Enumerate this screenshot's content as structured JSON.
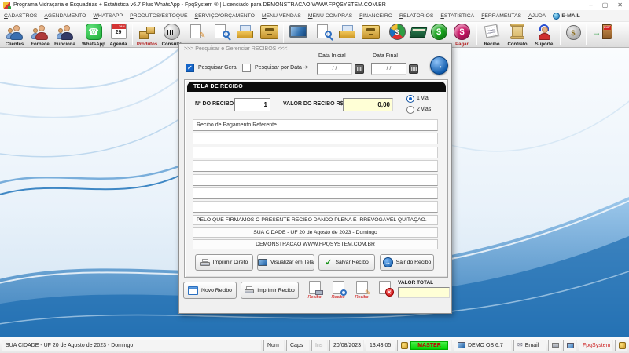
{
  "icons": {
    "check": "✓",
    "arrow": "→",
    "phone": "☎",
    "pencil": "✎",
    "dollar": "$",
    "x_mark": "✕",
    "envelope": "✉"
  },
  "window": {
    "title": "Programa Vidraçaria e Esquadrias + Estatistica v6.7 Plus WhatsApp - FpqSystem ® | Licenciado para DEMONSTRACAO WWW.FPQSYSTEM.COM.BR",
    "minimize": "–",
    "maximize": "▢",
    "close": "✕"
  },
  "menubar": {
    "items": [
      "CADASTROS",
      "AGENDAMENTO",
      "WHATSAPP",
      "PRODUTOS/ESTOQUE",
      "SERVIÇO/ORÇAMENTO",
      "MENU VENDAS",
      "MENU COMPRAS",
      "FINANCEIRO",
      "RELATÓRIOS",
      "ESTATISTICA",
      "FERRAMENTAS",
      "AJUDA"
    ],
    "email": "E-MAIL"
  },
  "toolbar": {
    "clientes": "Clientes",
    "fornece": "Fornece",
    "funciona": "Funciona",
    "whatsapp": "WhatsApp",
    "agenda": "Agenda",
    "agenda_month": "JAN",
    "agenda_day": "29",
    "produtos": "Produtos",
    "consulta": "Consulta",
    "pagar": "Pagar",
    "recibo": "Recibo",
    "contrato": "Contrato",
    "suporte": "Suporte",
    "exit_sign": "EXIT"
  },
  "dialog": {
    "title": ">>> Pesquisar e Gerenciar RECIBOS  <<<",
    "pesquisar_geral": "Pesquisar Geral",
    "pesquisar_por_data": "Pesquisar por Data ->",
    "data_inicial": {
      "label": "Data Inicial",
      "value": "/ /"
    },
    "data_final": {
      "label": "Data Final",
      "value": "/ /"
    },
    "tela": {
      "header": "TELA DE RECIBO",
      "numero_label": "Nº DO RECIBO",
      "numero_value": "1",
      "valor_label": "VALOR DO RECIBO R$",
      "valor_value": "0,00",
      "via_1": "1 via",
      "via_2": "2 vias",
      "linha1": "Recibo de Pagamento Referente",
      "quitacao": "PELO QUE FIRMAMOS O PRESENTE RECIBO DANDO PLENA E IRREVOGÁVEL QUITAÇÃO.",
      "cidade": "SUA CIDADE - UF 20 de Agosto de 2023 - Domingo",
      "demonstracao": "DEMONSTRACAO WWW.FPQSYSTEM.COM.BR",
      "btn_imprimir_direto": "Imprimir Direto",
      "btn_visualizar": "Visualizar em Tela",
      "btn_salvar": "Salvar Recibo",
      "btn_sair": "Sair do Recibo"
    },
    "footer": {
      "btn_novo": "Novo Recibo",
      "btn_imprimir": "Imprimir Recibo",
      "mini_labels": [
        "Recibo",
        "Recibo",
        "Recibo",
        ""
      ],
      "valor_total_label": "VALOR TOTAL",
      "valor_total_value": ""
    }
  },
  "statusbar": {
    "cidade": "SUA CIDADE - UF 20 de Agosto de 2023 - Domingo",
    "num": "Num",
    "caps": "Caps",
    "ins": "Ins",
    "data": "20/08/2023",
    "hora": "13:43:05",
    "master": "MASTER",
    "sistema": "DEMO OS 6.7",
    "email": "Email",
    "marca": "FpqSystem"
  }
}
